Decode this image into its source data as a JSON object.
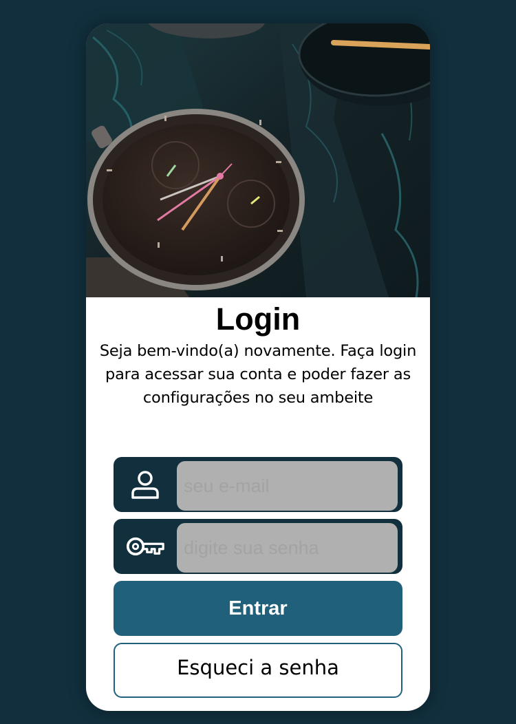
{
  "login": {
    "title": "Login",
    "subtitle": "Seja bem-vindo(a) novamente. Faça login para acessar sua conta e poder fazer as configurações no seu ambeite",
    "email_placeholder": "seu e-mail",
    "password_placeholder": "digite sua senha",
    "submit_label": "Entrar",
    "forgot_label": "Esqueci a senha"
  },
  "icons": {
    "email": "user-icon",
    "password": "key-icon"
  },
  "colors": {
    "background": "#112f3d",
    "primary": "#20607a",
    "input_fill": "#b0b0b0"
  }
}
